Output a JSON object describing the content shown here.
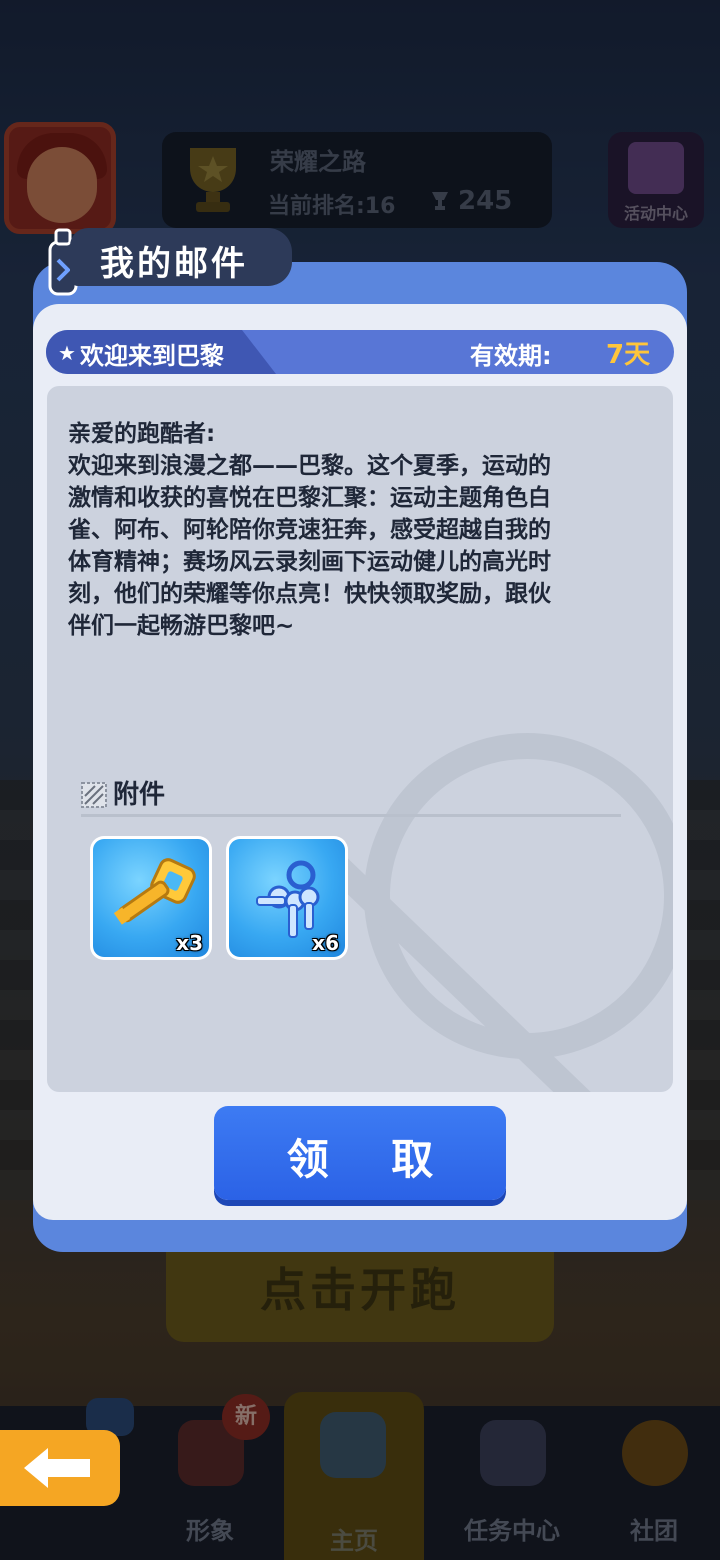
{
  "background": {
    "rank_panel": {
      "title": "荣耀之路",
      "rank_text": "当前排名:16",
      "score": "245"
    },
    "event_center_label": "活动中心",
    "start_run_label": "点击开跑",
    "nav": {
      "items": [
        {
          "label": "形象",
          "icon": "character-icon"
        },
        {
          "label": "主页",
          "icon": "home-board-icon"
        },
        {
          "label": "任务中心",
          "icon": "task-icon"
        },
        {
          "label": "社团",
          "icon": "club-icon"
        }
      ],
      "new_badge": "新"
    }
  },
  "dialog": {
    "title": "我的邮件",
    "mail": {
      "subject": "欢迎来到巴黎",
      "expiry_label": "有效期:",
      "expiry_value": "7天",
      "body_lines": [
        "亲爱的跑酷者:",
        "欢迎来到浪漫之都——巴黎。这个夏季，运动的",
        "激情和收获的喜悦在巴黎汇聚：运动主题角色白",
        "雀、阿布、阿轮陪你竞速狂奔，感受超越自我的",
        "体育精神；赛场风云录刻画下运动健儿的高光时",
        "刻，他们的荣耀等你点亮！快快领取奖励，跟伙",
        "伴们一起畅游巴黎吧~"
      ]
    },
    "attachments": {
      "label": "附件",
      "items": [
        {
          "icon": "golden-key-icon",
          "quantity": "x3"
        },
        {
          "icon": "blue-keys-icon",
          "quantity": "x6"
        }
      ]
    },
    "claim_label": "领 取"
  },
  "colors": {
    "dialog_frame": "#5b86dd",
    "claim_button": "#2b62e6",
    "expiry_value": "#ffc53a",
    "back_button": "#f5a623"
  }
}
